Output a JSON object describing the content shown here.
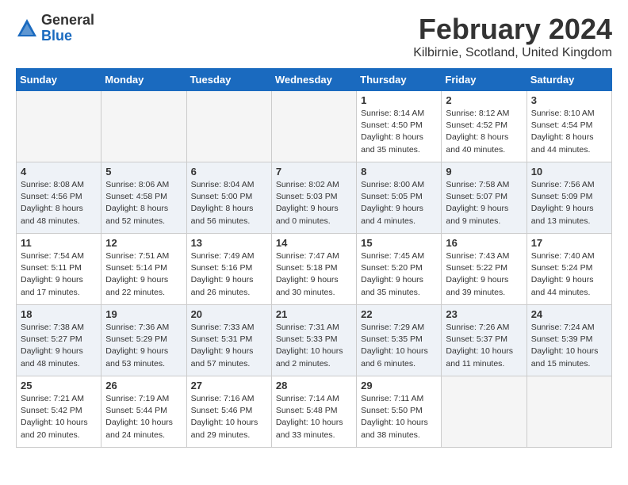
{
  "logo": {
    "general": "General",
    "blue": "Blue"
  },
  "title": "February 2024",
  "location": "Kilbirnie, Scotland, United Kingdom",
  "days_of_week": [
    "Sunday",
    "Monday",
    "Tuesday",
    "Wednesday",
    "Thursday",
    "Friday",
    "Saturday"
  ],
  "weeks": [
    [
      {
        "day": "",
        "info": ""
      },
      {
        "day": "",
        "info": ""
      },
      {
        "day": "",
        "info": ""
      },
      {
        "day": "",
        "info": ""
      },
      {
        "day": "1",
        "info": "Sunrise: 8:14 AM\nSunset: 4:50 PM\nDaylight: 8 hours\nand 35 minutes."
      },
      {
        "day": "2",
        "info": "Sunrise: 8:12 AM\nSunset: 4:52 PM\nDaylight: 8 hours\nand 40 minutes."
      },
      {
        "day": "3",
        "info": "Sunrise: 8:10 AM\nSunset: 4:54 PM\nDaylight: 8 hours\nand 44 minutes."
      }
    ],
    [
      {
        "day": "4",
        "info": "Sunrise: 8:08 AM\nSunset: 4:56 PM\nDaylight: 8 hours\nand 48 minutes."
      },
      {
        "day": "5",
        "info": "Sunrise: 8:06 AM\nSunset: 4:58 PM\nDaylight: 8 hours\nand 52 minutes."
      },
      {
        "day": "6",
        "info": "Sunrise: 8:04 AM\nSunset: 5:00 PM\nDaylight: 8 hours\nand 56 minutes."
      },
      {
        "day": "7",
        "info": "Sunrise: 8:02 AM\nSunset: 5:03 PM\nDaylight: 9 hours\nand 0 minutes."
      },
      {
        "day": "8",
        "info": "Sunrise: 8:00 AM\nSunset: 5:05 PM\nDaylight: 9 hours\nand 4 minutes."
      },
      {
        "day": "9",
        "info": "Sunrise: 7:58 AM\nSunset: 5:07 PM\nDaylight: 9 hours\nand 9 minutes."
      },
      {
        "day": "10",
        "info": "Sunrise: 7:56 AM\nSunset: 5:09 PM\nDaylight: 9 hours\nand 13 minutes."
      }
    ],
    [
      {
        "day": "11",
        "info": "Sunrise: 7:54 AM\nSunset: 5:11 PM\nDaylight: 9 hours\nand 17 minutes."
      },
      {
        "day": "12",
        "info": "Sunrise: 7:51 AM\nSunset: 5:14 PM\nDaylight: 9 hours\nand 22 minutes."
      },
      {
        "day": "13",
        "info": "Sunrise: 7:49 AM\nSunset: 5:16 PM\nDaylight: 9 hours\nand 26 minutes."
      },
      {
        "day": "14",
        "info": "Sunrise: 7:47 AM\nSunset: 5:18 PM\nDaylight: 9 hours\nand 30 minutes."
      },
      {
        "day": "15",
        "info": "Sunrise: 7:45 AM\nSunset: 5:20 PM\nDaylight: 9 hours\nand 35 minutes."
      },
      {
        "day": "16",
        "info": "Sunrise: 7:43 AM\nSunset: 5:22 PM\nDaylight: 9 hours\nand 39 minutes."
      },
      {
        "day": "17",
        "info": "Sunrise: 7:40 AM\nSunset: 5:24 PM\nDaylight: 9 hours\nand 44 minutes."
      }
    ],
    [
      {
        "day": "18",
        "info": "Sunrise: 7:38 AM\nSunset: 5:27 PM\nDaylight: 9 hours\nand 48 minutes."
      },
      {
        "day": "19",
        "info": "Sunrise: 7:36 AM\nSunset: 5:29 PM\nDaylight: 9 hours\nand 53 minutes."
      },
      {
        "day": "20",
        "info": "Sunrise: 7:33 AM\nSunset: 5:31 PM\nDaylight: 9 hours\nand 57 minutes."
      },
      {
        "day": "21",
        "info": "Sunrise: 7:31 AM\nSunset: 5:33 PM\nDaylight: 10 hours\nand 2 minutes."
      },
      {
        "day": "22",
        "info": "Sunrise: 7:29 AM\nSunset: 5:35 PM\nDaylight: 10 hours\nand 6 minutes."
      },
      {
        "day": "23",
        "info": "Sunrise: 7:26 AM\nSunset: 5:37 PM\nDaylight: 10 hours\nand 11 minutes."
      },
      {
        "day": "24",
        "info": "Sunrise: 7:24 AM\nSunset: 5:39 PM\nDaylight: 10 hours\nand 15 minutes."
      }
    ],
    [
      {
        "day": "25",
        "info": "Sunrise: 7:21 AM\nSunset: 5:42 PM\nDaylight: 10 hours\nand 20 minutes."
      },
      {
        "day": "26",
        "info": "Sunrise: 7:19 AM\nSunset: 5:44 PM\nDaylight: 10 hours\nand 24 minutes."
      },
      {
        "day": "27",
        "info": "Sunrise: 7:16 AM\nSunset: 5:46 PM\nDaylight: 10 hours\nand 29 minutes."
      },
      {
        "day": "28",
        "info": "Sunrise: 7:14 AM\nSunset: 5:48 PM\nDaylight: 10 hours\nand 33 minutes."
      },
      {
        "day": "29",
        "info": "Sunrise: 7:11 AM\nSunset: 5:50 PM\nDaylight: 10 hours\nand 38 minutes."
      },
      {
        "day": "",
        "info": ""
      },
      {
        "day": "",
        "info": ""
      }
    ]
  ]
}
